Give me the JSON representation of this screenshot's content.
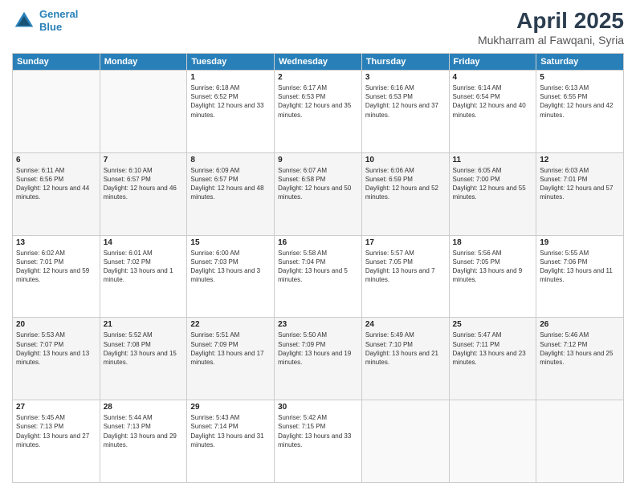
{
  "header": {
    "logo_line1": "General",
    "logo_line2": "Blue",
    "month_title": "April 2025",
    "subtitle": "Mukharram al Fawqani, Syria"
  },
  "days_of_week": [
    "Sunday",
    "Monday",
    "Tuesday",
    "Wednesday",
    "Thursday",
    "Friday",
    "Saturday"
  ],
  "weeks": [
    [
      {
        "day": "",
        "sunrise": "",
        "sunset": "",
        "daylight": ""
      },
      {
        "day": "",
        "sunrise": "",
        "sunset": "",
        "daylight": ""
      },
      {
        "day": "1",
        "sunrise": "Sunrise: 6:18 AM",
        "sunset": "Sunset: 6:52 PM",
        "daylight": "Daylight: 12 hours and 33 minutes."
      },
      {
        "day": "2",
        "sunrise": "Sunrise: 6:17 AM",
        "sunset": "Sunset: 6:53 PM",
        "daylight": "Daylight: 12 hours and 35 minutes."
      },
      {
        "day": "3",
        "sunrise": "Sunrise: 6:16 AM",
        "sunset": "Sunset: 6:53 PM",
        "daylight": "Daylight: 12 hours and 37 minutes."
      },
      {
        "day": "4",
        "sunrise": "Sunrise: 6:14 AM",
        "sunset": "Sunset: 6:54 PM",
        "daylight": "Daylight: 12 hours and 40 minutes."
      },
      {
        "day": "5",
        "sunrise": "Sunrise: 6:13 AM",
        "sunset": "Sunset: 6:55 PM",
        "daylight": "Daylight: 12 hours and 42 minutes."
      }
    ],
    [
      {
        "day": "6",
        "sunrise": "Sunrise: 6:11 AM",
        "sunset": "Sunset: 6:56 PM",
        "daylight": "Daylight: 12 hours and 44 minutes."
      },
      {
        "day": "7",
        "sunrise": "Sunrise: 6:10 AM",
        "sunset": "Sunset: 6:57 PM",
        "daylight": "Daylight: 12 hours and 46 minutes."
      },
      {
        "day": "8",
        "sunrise": "Sunrise: 6:09 AM",
        "sunset": "Sunset: 6:57 PM",
        "daylight": "Daylight: 12 hours and 48 minutes."
      },
      {
        "day": "9",
        "sunrise": "Sunrise: 6:07 AM",
        "sunset": "Sunset: 6:58 PM",
        "daylight": "Daylight: 12 hours and 50 minutes."
      },
      {
        "day": "10",
        "sunrise": "Sunrise: 6:06 AM",
        "sunset": "Sunset: 6:59 PM",
        "daylight": "Daylight: 12 hours and 52 minutes."
      },
      {
        "day": "11",
        "sunrise": "Sunrise: 6:05 AM",
        "sunset": "Sunset: 7:00 PM",
        "daylight": "Daylight: 12 hours and 55 minutes."
      },
      {
        "day": "12",
        "sunrise": "Sunrise: 6:03 AM",
        "sunset": "Sunset: 7:01 PM",
        "daylight": "Daylight: 12 hours and 57 minutes."
      }
    ],
    [
      {
        "day": "13",
        "sunrise": "Sunrise: 6:02 AM",
        "sunset": "Sunset: 7:01 PM",
        "daylight": "Daylight: 12 hours and 59 minutes."
      },
      {
        "day": "14",
        "sunrise": "Sunrise: 6:01 AM",
        "sunset": "Sunset: 7:02 PM",
        "daylight": "Daylight: 13 hours and 1 minute."
      },
      {
        "day": "15",
        "sunrise": "Sunrise: 6:00 AM",
        "sunset": "Sunset: 7:03 PM",
        "daylight": "Daylight: 13 hours and 3 minutes."
      },
      {
        "day": "16",
        "sunrise": "Sunrise: 5:58 AM",
        "sunset": "Sunset: 7:04 PM",
        "daylight": "Daylight: 13 hours and 5 minutes."
      },
      {
        "day": "17",
        "sunrise": "Sunrise: 5:57 AM",
        "sunset": "Sunset: 7:05 PM",
        "daylight": "Daylight: 13 hours and 7 minutes."
      },
      {
        "day": "18",
        "sunrise": "Sunrise: 5:56 AM",
        "sunset": "Sunset: 7:05 PM",
        "daylight": "Daylight: 13 hours and 9 minutes."
      },
      {
        "day": "19",
        "sunrise": "Sunrise: 5:55 AM",
        "sunset": "Sunset: 7:06 PM",
        "daylight": "Daylight: 13 hours and 11 minutes."
      }
    ],
    [
      {
        "day": "20",
        "sunrise": "Sunrise: 5:53 AM",
        "sunset": "Sunset: 7:07 PM",
        "daylight": "Daylight: 13 hours and 13 minutes."
      },
      {
        "day": "21",
        "sunrise": "Sunrise: 5:52 AM",
        "sunset": "Sunset: 7:08 PM",
        "daylight": "Daylight: 13 hours and 15 minutes."
      },
      {
        "day": "22",
        "sunrise": "Sunrise: 5:51 AM",
        "sunset": "Sunset: 7:09 PM",
        "daylight": "Daylight: 13 hours and 17 minutes."
      },
      {
        "day": "23",
        "sunrise": "Sunrise: 5:50 AM",
        "sunset": "Sunset: 7:09 PM",
        "daylight": "Daylight: 13 hours and 19 minutes."
      },
      {
        "day": "24",
        "sunrise": "Sunrise: 5:49 AM",
        "sunset": "Sunset: 7:10 PM",
        "daylight": "Daylight: 13 hours and 21 minutes."
      },
      {
        "day": "25",
        "sunrise": "Sunrise: 5:47 AM",
        "sunset": "Sunset: 7:11 PM",
        "daylight": "Daylight: 13 hours and 23 minutes."
      },
      {
        "day": "26",
        "sunrise": "Sunrise: 5:46 AM",
        "sunset": "Sunset: 7:12 PM",
        "daylight": "Daylight: 13 hours and 25 minutes."
      }
    ],
    [
      {
        "day": "27",
        "sunrise": "Sunrise: 5:45 AM",
        "sunset": "Sunset: 7:13 PM",
        "daylight": "Daylight: 13 hours and 27 minutes."
      },
      {
        "day": "28",
        "sunrise": "Sunrise: 5:44 AM",
        "sunset": "Sunset: 7:13 PM",
        "daylight": "Daylight: 13 hours and 29 minutes."
      },
      {
        "day": "29",
        "sunrise": "Sunrise: 5:43 AM",
        "sunset": "Sunset: 7:14 PM",
        "daylight": "Daylight: 13 hours and 31 minutes."
      },
      {
        "day": "30",
        "sunrise": "Sunrise: 5:42 AM",
        "sunset": "Sunset: 7:15 PM",
        "daylight": "Daylight: 13 hours and 33 minutes."
      },
      {
        "day": "",
        "sunrise": "",
        "sunset": "",
        "daylight": ""
      },
      {
        "day": "",
        "sunrise": "",
        "sunset": "",
        "daylight": ""
      },
      {
        "day": "",
        "sunrise": "",
        "sunset": "",
        "daylight": ""
      }
    ]
  ]
}
